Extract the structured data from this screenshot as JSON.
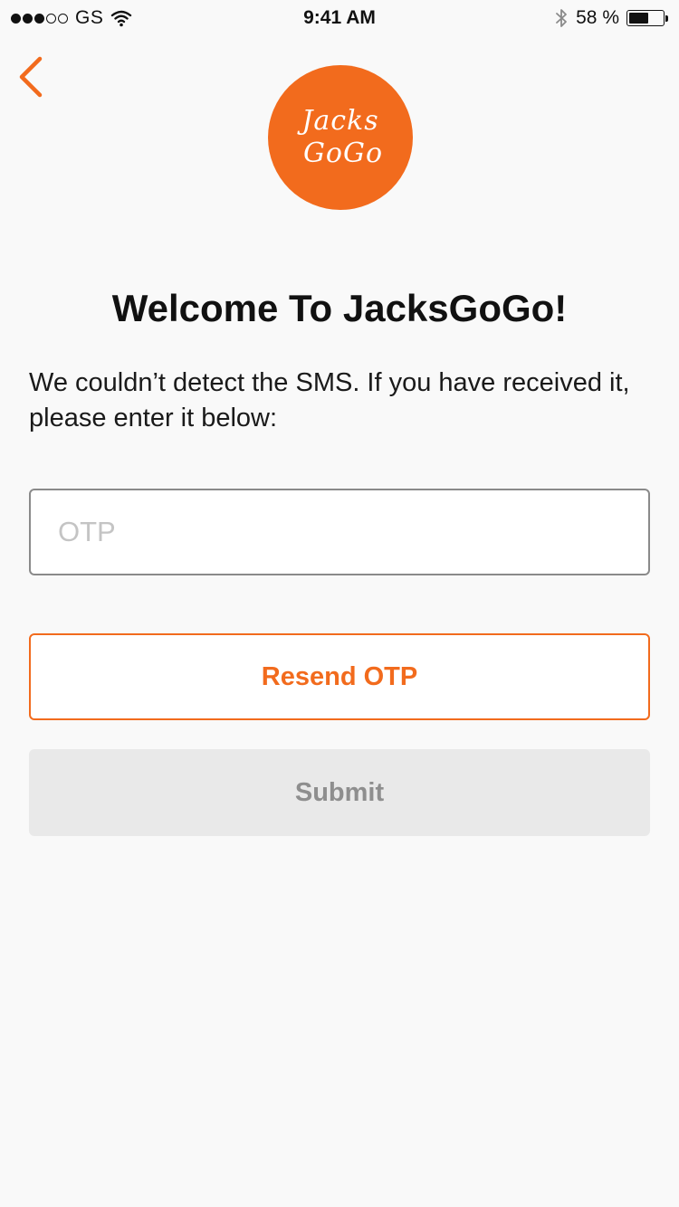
{
  "status_bar": {
    "signal_filled": 3,
    "signal_total": 5,
    "carrier": "GS",
    "time": "9:41 AM",
    "battery_percent_text": "58 %",
    "battery_level": 0.58,
    "icons": [
      "wifi-icon",
      "bluetooth-icon",
      "battery-icon"
    ]
  },
  "header": {
    "back_icon": "chevron-left-icon"
  },
  "logo": {
    "line1": "Jacks",
    "line2": "GoGo",
    "color": "#f26b1d"
  },
  "main": {
    "title": "Welcome To JacksGoGo!",
    "message": "We couldn’t detect the SMS. If you have received it, please enter it below:",
    "otp_placeholder": "OTP",
    "otp_value": "",
    "resend_label": "Resend OTP",
    "submit_label": "Submit"
  },
  "colors": {
    "accent": "#f26b1d",
    "background": "#f9f9f9",
    "disabled_button": "#e9e9e9",
    "disabled_text": "#8e8e8e"
  }
}
